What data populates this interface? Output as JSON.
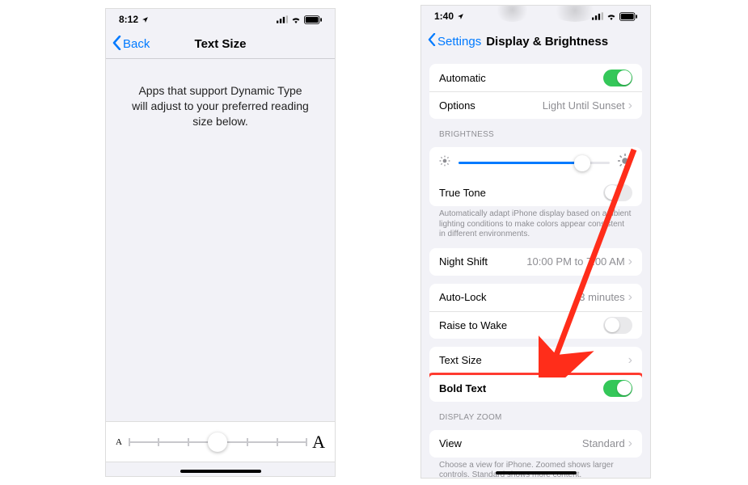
{
  "left": {
    "time": "8:12",
    "back_label": "Back",
    "title": "Text Size",
    "description": "Apps that support Dynamic Type will adjust to your preferred reading size below.",
    "slider_small": "A",
    "slider_big": "A",
    "thumb_position_pct": 50
  },
  "right": {
    "time": "1:40",
    "back_label": "Settings",
    "title": "Display & Brightness",
    "rows": {
      "automatic": {
        "label": "Automatic",
        "on": true
      },
      "options": {
        "label": "Options",
        "detail": "Light Until Sunset"
      },
      "brightness_header": "BRIGHTNESS",
      "brightness_pct": 82,
      "true_tone": {
        "label": "True Tone",
        "on": false
      },
      "true_tone_footer": "Automatically adapt iPhone display based on ambient lighting conditions to make colors appear consistent in different environments.",
      "night_shift": {
        "label": "Night Shift",
        "detail": "10:00 PM to 7:00 AM"
      },
      "auto_lock": {
        "label": "Auto-Lock",
        "detail": "3 minutes"
      },
      "raise_to_wake": {
        "label": "Raise to Wake",
        "on": false
      },
      "text_size": {
        "label": "Text Size"
      },
      "bold_text": {
        "label": "Bold Text",
        "on": true
      },
      "display_zoom_header": "DISPLAY ZOOM",
      "view": {
        "label": "View",
        "detail": "Standard"
      },
      "view_footer": "Choose a view for iPhone. Zoomed shows larger controls. Standard shows more content."
    }
  }
}
